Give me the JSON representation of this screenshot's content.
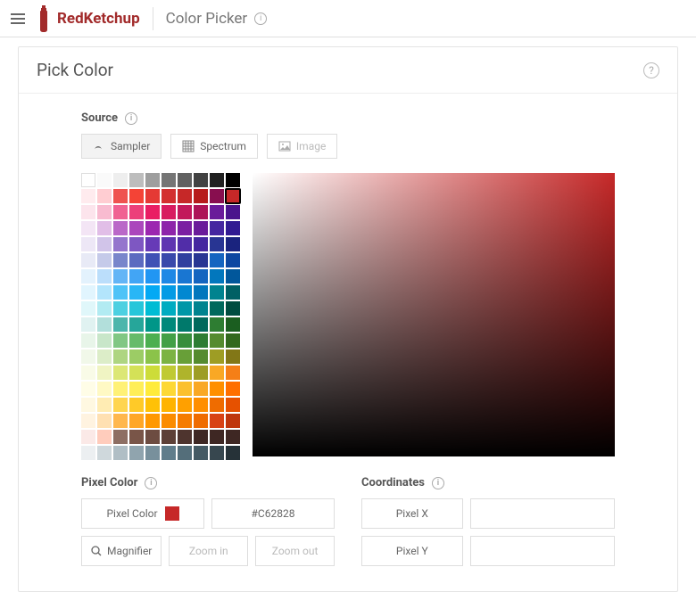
{
  "header": {
    "brand": "RedKetchup",
    "page_title": "Color Picker"
  },
  "panel": {
    "title": "Pick Color"
  },
  "source": {
    "label": "Source",
    "tabs": {
      "sampler": "Sampler",
      "spectrum": "Spectrum",
      "image": "Image"
    }
  },
  "palette": {
    "selected_index": 19,
    "colors": [
      "#FFFFFF",
      "#FAFAFA",
      "#EEEEEE",
      "#BDBDBD",
      "#9E9E9E",
      "#757575",
      "#616161",
      "#424242",
      "#212121",
      "#000000",
      "#FFEBEE",
      "#FFCDD2",
      "#EF5350",
      "#F44336",
      "#E53935",
      "#D32F2F",
      "#C62828",
      "#B71C1C",
      "#880E4F",
      "#C62828",
      "#FCE4EC",
      "#F8BBD0",
      "#F06292",
      "#EC407A",
      "#E91E63",
      "#D81B60",
      "#C2185B",
      "#AD1457",
      "#6A1B9A",
      "#4A148C",
      "#F3E5F5",
      "#E1BEE7",
      "#BA68C8",
      "#AB47BC",
      "#9C27B0",
      "#8E24AA",
      "#7B1FA2",
      "#6A1B9A",
      "#4527A0",
      "#311B92",
      "#EDE7F6",
      "#D1C4E9",
      "#9575CD",
      "#7E57C2",
      "#673AB7",
      "#5E35B1",
      "#512DA8",
      "#4527A0",
      "#283593",
      "#1A237E",
      "#E8EAF6",
      "#C5CAE9",
      "#7986CB",
      "#5C6BC0",
      "#3F51B5",
      "#3949AB",
      "#303F9F",
      "#283593",
      "#1565C0",
      "#0D47A1",
      "#E3F2FD",
      "#BBDEFB",
      "#64B5F6",
      "#42A5F5",
      "#2196F3",
      "#1E88E5",
      "#1976D2",
      "#1565C0",
      "#0277BD",
      "#01579B",
      "#E1F5FE",
      "#B3E5FC",
      "#4FC3F7",
      "#29B6F6",
      "#03A9F4",
      "#039BE5",
      "#0288D1",
      "#0277BD",
      "#00838F",
      "#006064",
      "#E0F7FA",
      "#B2EBF2",
      "#4DD0E1",
      "#26C6DA",
      "#00BCD4",
      "#00ACC1",
      "#0097A7",
      "#00838F",
      "#00695C",
      "#004D40",
      "#E0F2F1",
      "#B2DFDB",
      "#4DB6AC",
      "#26A69A",
      "#009688",
      "#00897B",
      "#00796B",
      "#00695C",
      "#2E7D32",
      "#1B5E20",
      "#E8F5E9",
      "#C8E6C9",
      "#81C784",
      "#66BB6A",
      "#4CAF50",
      "#43A047",
      "#388E3C",
      "#2E7D32",
      "#558B2F",
      "#33691E",
      "#F1F8E9",
      "#DCEDC8",
      "#AED581",
      "#9CCC65",
      "#8BC34A",
      "#7CB342",
      "#689F38",
      "#558B2F",
      "#9E9D24",
      "#827717",
      "#F9FBE7",
      "#F0F4C3",
      "#DCE775",
      "#D4E157",
      "#CDDC39",
      "#C0CA33",
      "#AFB42B",
      "#9E9D24",
      "#F9A825",
      "#F57F17",
      "#FFFDE7",
      "#FFF9C4",
      "#FFF176",
      "#FFEE58",
      "#FFEB3B",
      "#FDD835",
      "#FBC02D",
      "#F9A825",
      "#FF8F00",
      "#FF6F00",
      "#FFF8E1",
      "#FFECB3",
      "#FFD54F",
      "#FFCA28",
      "#FFC107",
      "#FFB300",
      "#FFA000",
      "#FF8F00",
      "#EF6C00",
      "#E65100",
      "#FFF3E0",
      "#FFE0B2",
      "#FFB74D",
      "#FFA726",
      "#FF9800",
      "#FB8C00",
      "#F57C00",
      "#EF6C00",
      "#D84315",
      "#BF360C",
      "#FBE9E7",
      "#FFCCBC",
      "#8D6E63",
      "#795548",
      "#6D4C41",
      "#5D4037",
      "#4E342E",
      "#3E2723",
      "#3E2723",
      "#3E2723",
      "#ECEFF1",
      "#CFD8DC",
      "#B0BEC5",
      "#90A4AE",
      "#78909C",
      "#607D8B",
      "#546E7A",
      "#455A64",
      "#37474F",
      "#263238"
    ]
  },
  "pixel": {
    "section_label": "Pixel Color",
    "label": "Pixel Color",
    "hex": "#C62828",
    "magnifier": "Magnifier",
    "zoom_in": "Zoom in",
    "zoom_out": "Zoom out"
  },
  "coords": {
    "section_label": "Coordinates",
    "x_label": "Pixel X",
    "y_label": "Pixel Y",
    "x": "",
    "y": ""
  }
}
